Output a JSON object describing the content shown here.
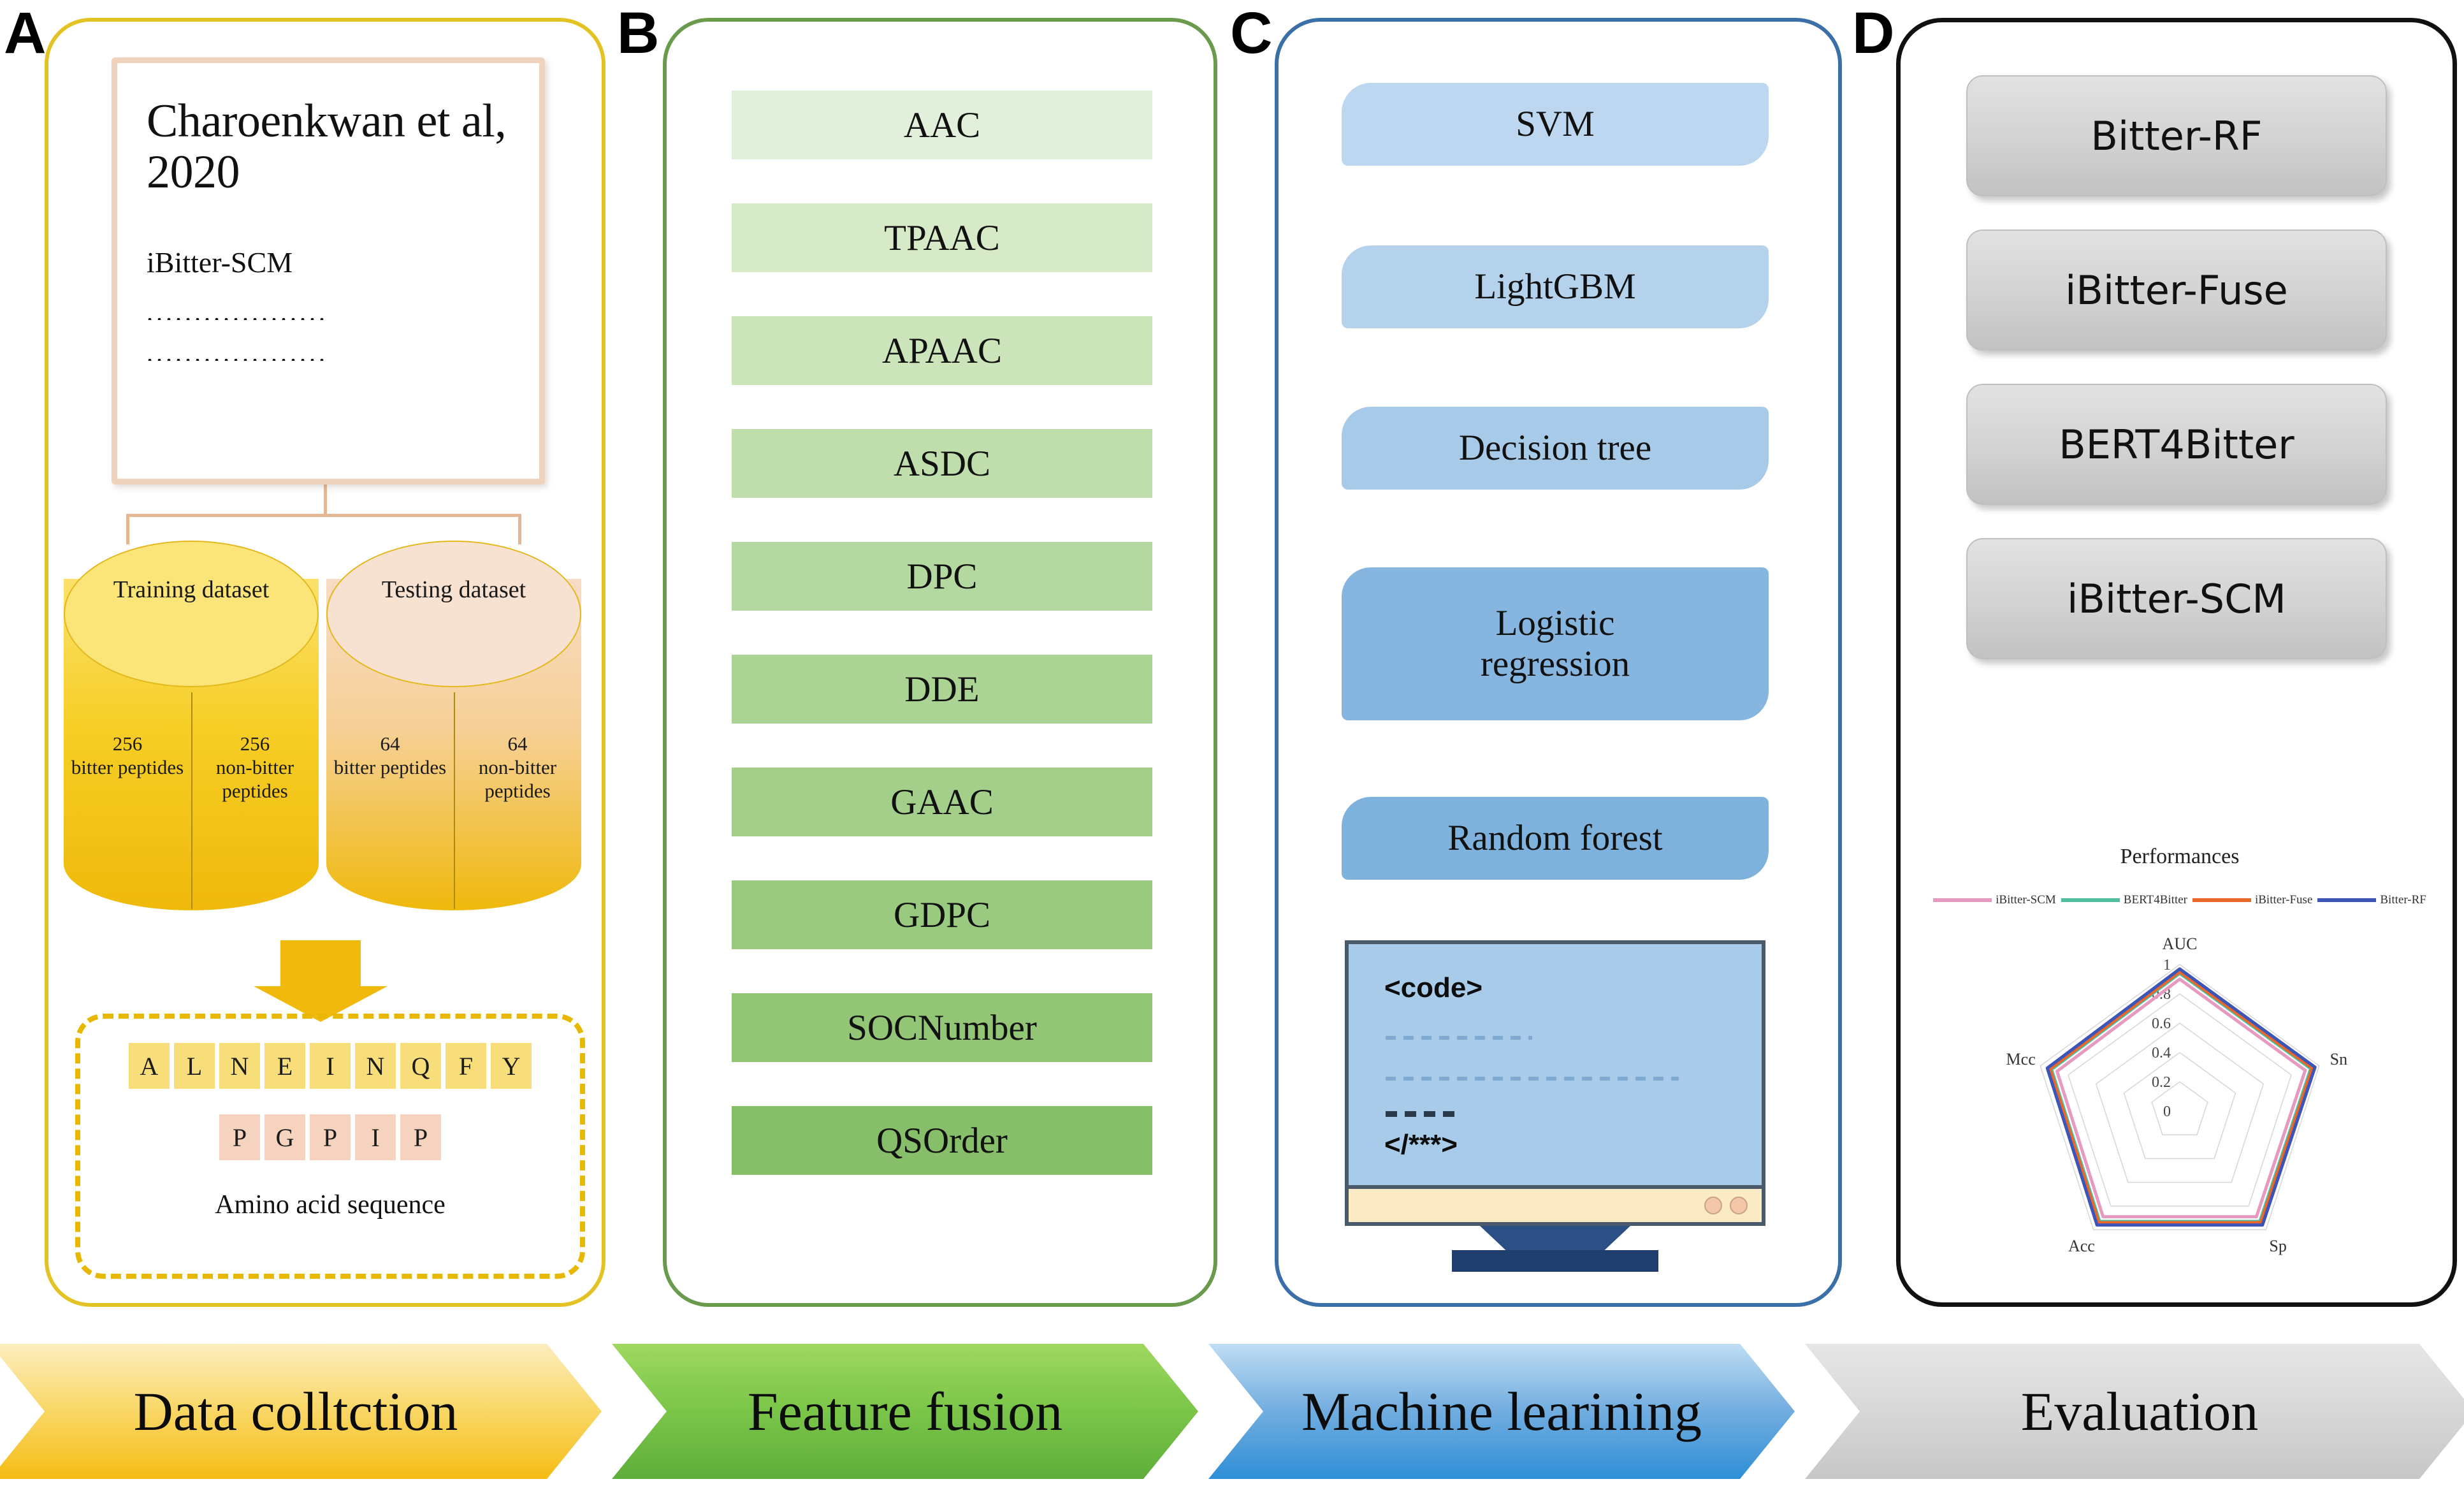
{
  "panels": {
    "a": {
      "letter": "A",
      "paper": {
        "title": "Charoenkwan\net al, 2020",
        "method": "iBitter-SCM",
        "dots1": "...................",
        "dots2": "..................."
      },
      "datasets": [
        {
          "name": "Training\ndataset",
          "left_count": "256",
          "left_label": "bitter\npeptides",
          "right_count": "256",
          "right_label": "non-bitter\npeptides"
        },
        {
          "name": "Testing\ndataset",
          "left_count": "64",
          "left_label": "bitter\npeptides",
          "right_count": "64",
          "right_label": "non-bitter\npeptides"
        }
      ],
      "sequence_row1": [
        "A",
        "L",
        "N",
        "E",
        "I",
        "N",
        "Q",
        "F",
        "Y"
      ],
      "sequence_row2": [
        "P",
        "G",
        "P",
        "I",
        "P"
      ],
      "sequence_caption": "Amino acid sequence"
    },
    "b": {
      "letter": "B",
      "features": [
        "AAC",
        "TPAAC",
        "APAAC",
        "ASDC",
        "DPC",
        "DDE",
        "GAAC",
        "GDPC",
        "SOCNumber",
        "QSOrder"
      ]
    },
    "c": {
      "letter": "C",
      "algorithms": [
        "SVM",
        "LightGBM",
        "Decision tree",
        "Logistic\nregression",
        "Random forest"
      ],
      "monitor": {
        "code_open": "<code>",
        "code_close": "</***>"
      }
    },
    "d": {
      "letter": "D",
      "models": [
        "Bitter-RF",
        "iBitter-Fuse",
        "BERT4Bitter",
        "iBitter-SCM"
      ]
    }
  },
  "banners": [
    {
      "label": "Data colltction",
      "color": "#F5BC14"
    },
    {
      "label": "Feature fusion",
      "color": "#5FAE3C"
    },
    {
      "label": "Machine learining",
      "color": "#2E8FD6"
    },
    {
      "label": "Evaluation",
      "color": "#C7C7C7"
    }
  ],
  "chart_data": {
    "type": "radar",
    "title": "Performances",
    "categories": [
      "AUC",
      "Sn",
      "Sp",
      "Acc",
      "Mcc"
    ],
    "rlim": [
      0,
      1
    ],
    "rticks": [
      "0",
      "0.2",
      "0.4",
      "0.6",
      "0.8",
      "1"
    ],
    "grid": true,
    "legend_position": "top",
    "series": [
      {
        "name": "iBitter-SCM",
        "color": "#E79AC0",
        "values": [
          0.9,
          0.9,
          0.89,
          0.89,
          0.88
        ]
      },
      {
        "name": "BERT4Bitter",
        "color": "#4FBFA0",
        "values": [
          0.94,
          0.94,
          0.93,
          0.93,
          0.92
        ]
      },
      {
        "name": "iBitter-Fuse",
        "color": "#E8672A",
        "values": [
          0.95,
          0.95,
          0.94,
          0.94,
          0.93
        ]
      },
      {
        "name": "Bitter-RF",
        "color": "#3B55B8",
        "values": [
          0.97,
          0.97,
          0.96,
          0.96,
          0.95
        ]
      }
    ]
  },
  "colors": {
    "panel_a_border": "#E3C323",
    "panel_b_border": "#6A9B4C",
    "panel_c_border": "#3A6FA8",
    "panel_d_border": "#111111"
  }
}
